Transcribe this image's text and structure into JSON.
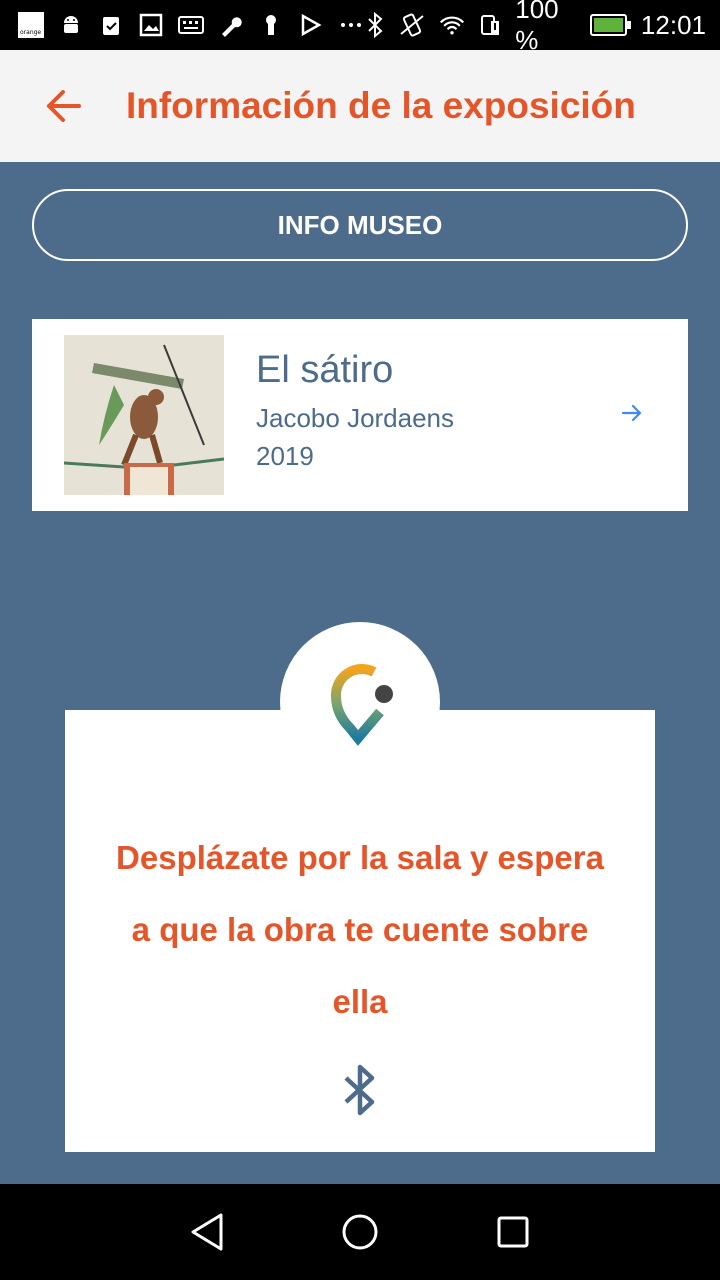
{
  "status_bar": {
    "carrier_logo_text": "orange",
    "battery_percent": "100 %",
    "time": "12:01",
    "icons": [
      "orange-logo-icon",
      "android-icon",
      "clipboard-check-icon",
      "image-icon",
      "keyboard-icon",
      "wrench-icon",
      "keyhole-icon",
      "send-check-icon",
      "more-icon",
      "bluetooth-icon",
      "vibrate-icon",
      "wifi-icon",
      "sim-alert-icon",
      "battery-charging-icon"
    ]
  },
  "app_bar": {
    "title": "Información de la exposición",
    "back_icon": "arrow-left-icon"
  },
  "info_button": {
    "label": "INFO MUSEO"
  },
  "artwork": {
    "title": "El sátiro",
    "author": "Jacobo Jordaens",
    "year": "2019",
    "arrow_icon": "arrow-right-icon"
  },
  "beacon": {
    "message_line_1": "Desplázate por la sala y espera",
    "message_line_2": "a que la obra te cuente sobre",
    "message_line_3": "ella",
    "icon": "bluetooth-icon"
  },
  "nav_bar": {
    "items": [
      "back-triangle-icon",
      "home-circle-icon",
      "recents-square-icon"
    ]
  },
  "colors": {
    "accent": "#e4562a",
    "background": "#4d6b8a",
    "card": "#ffffff",
    "app_bar_bg": "#f4f4f4",
    "arrow_blue": "#3d8bf2"
  }
}
